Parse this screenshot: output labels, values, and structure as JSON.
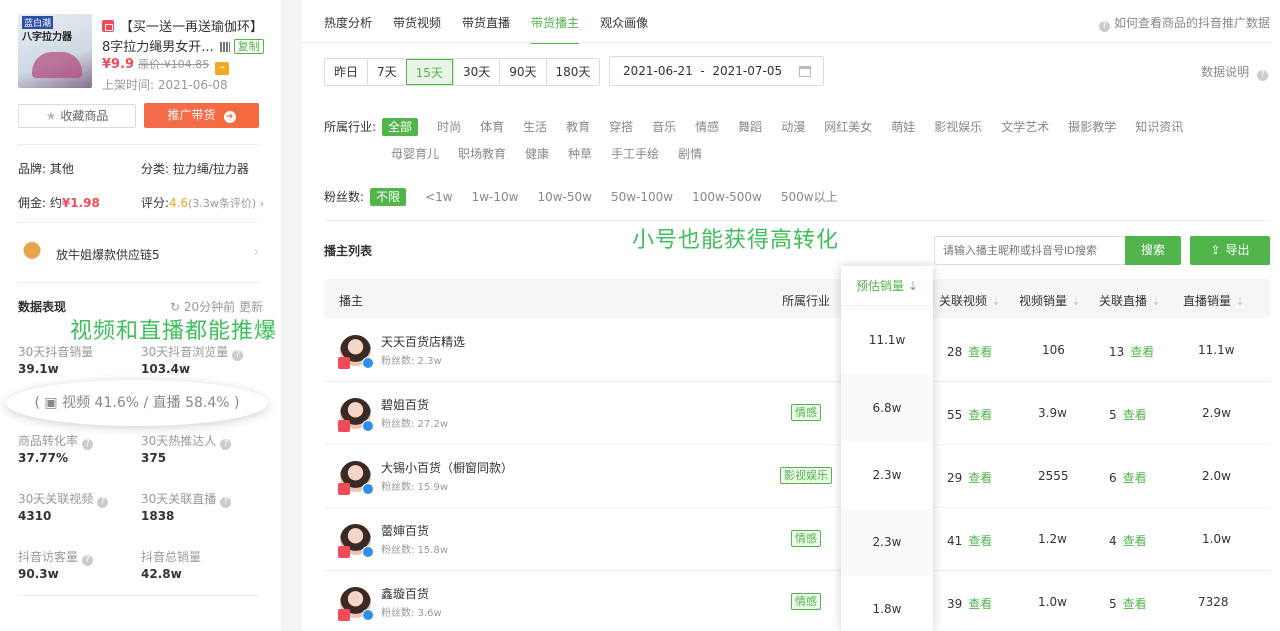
{
  "product": {
    "img_tag": "蓝白潮",
    "img_title": "八字拉力器",
    "title": "【买一送一再送瑜伽环】",
    "name": "8字拉力绳男女开...",
    "copy_label": "复制",
    "price": "¥9.9",
    "orig_price": "原价:¥104.85",
    "listed": "上架时间:  2021-06-08",
    "fav_label": "收藏商品",
    "promote_label": "推广带货",
    "brand": "品牌:  其他",
    "category": "分类:  拉力绳/拉力器",
    "commission_label": "佣金:  约",
    "commission_value": "¥1.98",
    "rating_label": "评分:",
    "rating_value": "4.6",
    "rating_count": "(3.3w条评价)",
    "supplier": "放牛姐爆款供应链5"
  },
  "data_panel": {
    "title": "数据表现",
    "updated": "20分钟前 更新",
    "overlay": "视频和直播都能推爆",
    "split": "视频 41.6%  /     直播 58.4%",
    "stats": [
      {
        "label": "30天抖音销量",
        "value": "39.1w"
      },
      {
        "label": "30天抖音浏览量",
        "value": "103.4w"
      },
      {
        "label": "商品转化率",
        "value": "37.77%"
      },
      {
        "label": "30天热推达人",
        "value": "375"
      },
      {
        "label": "30天关联视频",
        "value": "4310"
      },
      {
        "label": "30天关联直播",
        "value": "1838"
      },
      {
        "label": "抖音访客量",
        "value": "90.3w"
      },
      {
        "label": "抖音总销量",
        "value": "42.8w"
      }
    ]
  },
  "tabs": [
    "热度分析",
    "带货视频",
    "带货直播",
    "带货播主",
    "观众画像"
  ],
  "active_tab": "带货播主",
  "help_text": "如何查看商品的抖音推广数据",
  "ranges": [
    "昨日",
    "7天",
    "15天",
    "30天",
    "90天",
    "180天"
  ],
  "active_range": "15天",
  "date_start": "2021-06-21",
  "date_end": "2021-07-05",
  "data_explain": "数据说明",
  "industry_label": "所属行业:",
  "industries_row1": [
    "全部",
    "时尚",
    "体育",
    "生活",
    "教育",
    "穿搭",
    "音乐",
    "情感",
    "舞蹈",
    "动漫",
    "网红美女",
    "萌娃",
    "影视娱乐",
    "文学艺术",
    "摄影教学",
    "知识资讯"
  ],
  "industries_row2": [
    "母婴育儿",
    "职场教育",
    "健康",
    "种草",
    "手工手绘",
    "剧情"
  ],
  "fans_label": "粉丝数:",
  "fans_ranges": [
    "不限",
    "<1w",
    "1w-10w",
    "10w-50w",
    "50w-100w",
    "100w-500w",
    "500w以上"
  ],
  "overlay_right": "小号也能获得高转化",
  "list_title": "播主列表",
  "search_placeholder": "请输入播主昵称或抖音号ID搜索",
  "search_label": "搜索",
  "export_label": "导出",
  "columns": {
    "streamer": "播主",
    "industry": "所属行业",
    "est_sales": "预估销量",
    "videos": "关联视频",
    "video_sales": "视频销量",
    "lives": "关联直播",
    "live_sales": "直播销量"
  },
  "look_label": "查看",
  "rows": [
    {
      "name": "天天百货店精选",
      "fans": "粉丝数: 2.3w",
      "industry": "",
      "est_sales": "11.1w",
      "videos": "28",
      "video_sales": "106",
      "lives": "13",
      "live_sales": "11.1w"
    },
    {
      "name": "碧姐百货",
      "fans": "粉丝数: 27.2w",
      "industry": "情感",
      "est_sales": "6.8w",
      "videos": "55",
      "video_sales": "3.9w",
      "lives": "5",
      "live_sales": "2.9w"
    },
    {
      "name": "大锡小百货（橱窗同款）",
      "fans": "粉丝数: 15.9w",
      "industry": "影视娱乐",
      "est_sales": "2.3w",
      "videos": "29",
      "video_sales": "2555",
      "lives": "6",
      "live_sales": "2.0w"
    },
    {
      "name": "蕾婶百货",
      "fans": "粉丝数: 15.8w",
      "industry": "情感",
      "est_sales": "2.3w",
      "videos": "41",
      "video_sales": "1.2w",
      "lives": "4",
      "live_sales": "1.0w"
    },
    {
      "name": "鑫璇百货",
      "fans": "粉丝数: 3.6w",
      "industry": "情感",
      "est_sales": "1.8w",
      "videos": "39",
      "video_sales": "1.0w",
      "lives": "5",
      "live_sales": "7328"
    }
  ]
}
